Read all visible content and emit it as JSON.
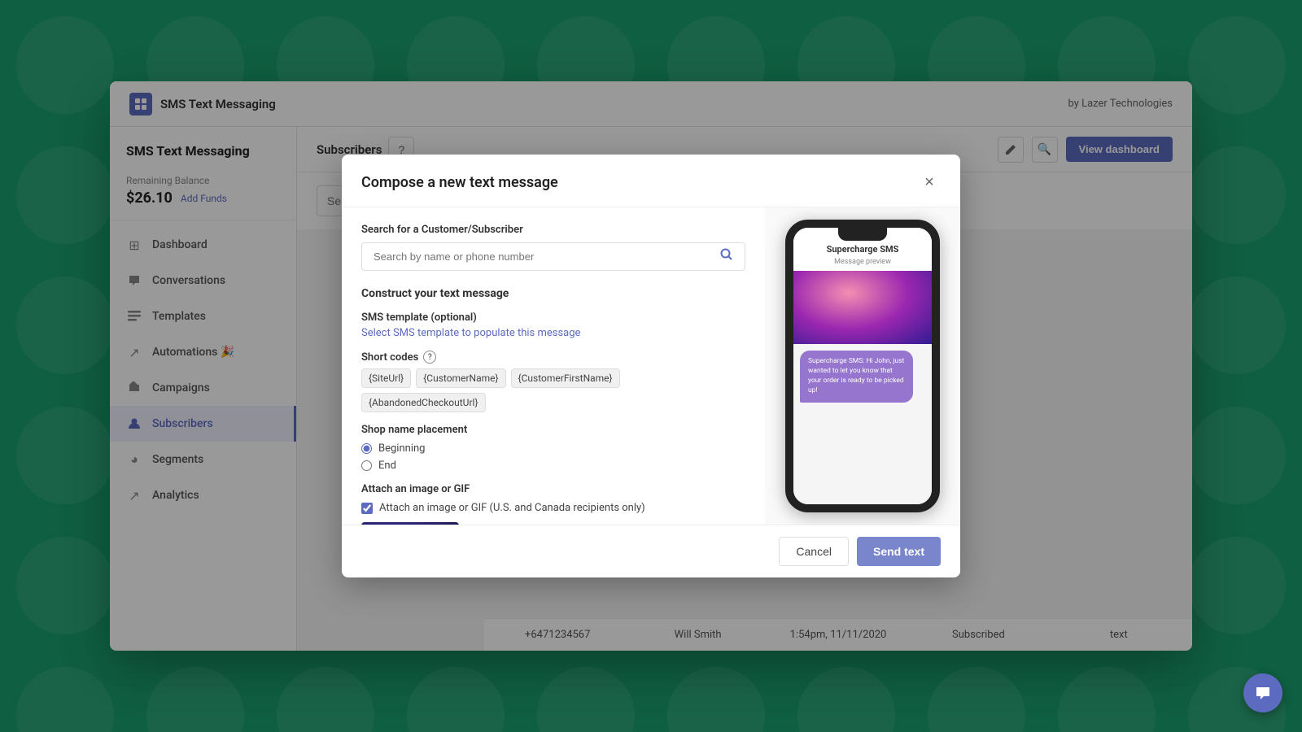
{
  "app": {
    "title": "SMS Text Messaging",
    "by": "by Lazer Technologies"
  },
  "sidebar": {
    "app_name": "SMS Text Messaging",
    "balance": {
      "label": "Remaining Balance",
      "amount": "$26.10",
      "add_funds": "Add Funds"
    },
    "nav": [
      {
        "id": "dashboard",
        "label": "Dashboard",
        "icon": "⊞",
        "active": false
      },
      {
        "id": "conversations",
        "label": "Conversations",
        "icon": "💬",
        "active": false
      },
      {
        "id": "templates",
        "label": "Templates",
        "icon": "☰",
        "active": false
      },
      {
        "id": "automations",
        "label": "Automations 🎉",
        "icon": "↗",
        "active": false
      },
      {
        "id": "campaigns",
        "label": "Campaigns",
        "icon": "💬",
        "active": false
      },
      {
        "id": "subscribers",
        "label": "Subscribers",
        "icon": "⚙",
        "active": true
      },
      {
        "id": "segments",
        "label": "Segments",
        "icon": "◕",
        "active": false
      },
      {
        "id": "analytics",
        "label": "Analytics",
        "icon": "↗",
        "active": false
      }
    ]
  },
  "content_header": {
    "title": "Subscribers",
    "view_dashboard": "View dashboard"
  },
  "search": {
    "placeholder": "Search DY name or phone number"
  },
  "modal": {
    "title": "Compose a new text message",
    "close_label": "×",
    "search_section": {
      "label": "Search for a Customer/Subscriber",
      "placeholder": "Search by name or phone number"
    },
    "construct_section": {
      "title": "Construct your text message",
      "sms_template": {
        "label": "SMS template (optional)",
        "link": "Select SMS template to populate this message"
      },
      "short_codes": {
        "label": "Short codes",
        "codes": [
          "{SiteUrl}",
          "{CustomerName}",
          "{CustomerFirstName}",
          "{AbandonedCheckoutUrl}"
        ]
      },
      "shop_name": {
        "label": "Shop name placement",
        "options": [
          "Beginning",
          "End"
        ],
        "selected": "Beginning"
      },
      "attach": {
        "label": "Attach an image or GIF",
        "checkbox_label": "Attach an image or GIF (U.S. and Canada recipients only)",
        "checked": true
      }
    },
    "phone_preview": {
      "app_name": "Supercharge SMS",
      "subtitle": "Message preview",
      "bubble_text": "Supercharge SMS: Hi John, just wanted to let you know that your order is ready to be picked up!"
    },
    "footer": {
      "cancel": "Cancel",
      "send": "Send text"
    }
  },
  "bottom_row": {
    "phone": "+6471234567",
    "name": "Will Smith",
    "date": "1:54pm, 11/11/2020",
    "status": "Subscribed",
    "type": "text"
  }
}
